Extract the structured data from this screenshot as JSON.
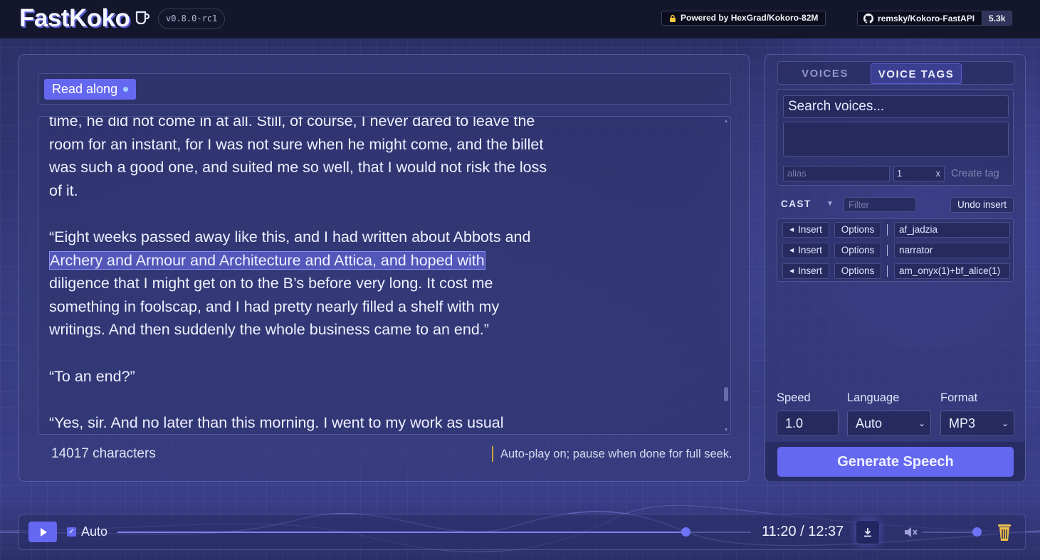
{
  "header": {
    "brand": "FastKoko",
    "version": "v0.8.0-rc1",
    "powered_by": "Powered by HexGrad/Kokoro-82M",
    "repo": "remsky/Kokoro-FastAPI",
    "stars": "5.3k"
  },
  "editor": {
    "read_along_label": "Read along",
    "paragraphs": [
      "time, he did not come in at all. Still, of course, I never dared to leave the room for an instant, for I was not sure when he might come, and the billet was such a good one, and suited me so well, that I would not risk the loss of it.",
      "“Eight weeks passed away like this, and I had written about Abbots and",
      "diligence that I might get on to the B’s before very long. It cost me something in foolscap, and I had pretty nearly filled a shelf with my writings. And then suddenly the whole business came to an end.”",
      "“To an end?”",
      "“Yes, sir. And no later than this morning. I went to my work as usual"
    ],
    "highlighted_text": "Archery and Armour and Architecture and Attica, and hoped with",
    "char_count": "14017 characters",
    "autoplay_note": "Auto-play on; pause when done for full seek."
  },
  "side": {
    "tabs": [
      {
        "label": "VOICES"
      },
      {
        "label": "VOICE TAGS"
      }
    ],
    "active_tab": "VOICE TAGS",
    "search_placeholder": "Search voices...",
    "alias_placeholder": "alias",
    "weight_value": "1",
    "weight_clear": "x",
    "create_tag": "Create tag",
    "cast_label": "CAST",
    "filter_placeholder": "Filter",
    "undo_label": "Undo insert",
    "insert_label": "Insert",
    "options_label": "Options",
    "cast": [
      {
        "tag": "af_jadzia"
      },
      {
        "tag": "narrator"
      },
      {
        "tag": "am_onyx(1)+bf_alice(1)"
      }
    ],
    "speed_label": "Speed",
    "speed_value": "1.0",
    "language_label": "Language",
    "language_value": "Auto",
    "format_label": "Format",
    "format_value": "MP3",
    "generate_label": "Generate Speech"
  },
  "player": {
    "auto_label": "Auto",
    "time": "11:20 / 12:37",
    "progress_fraction": 0.897,
    "volume_fraction": 1.0
  },
  "colors": {
    "accent": "#6468f0",
    "header_bg": "#14172c"
  },
  "icons": [
    "cup-icon",
    "lock-icon",
    "github-icon",
    "play-icon",
    "download-icon",
    "mute-icon",
    "trash-icon"
  ]
}
